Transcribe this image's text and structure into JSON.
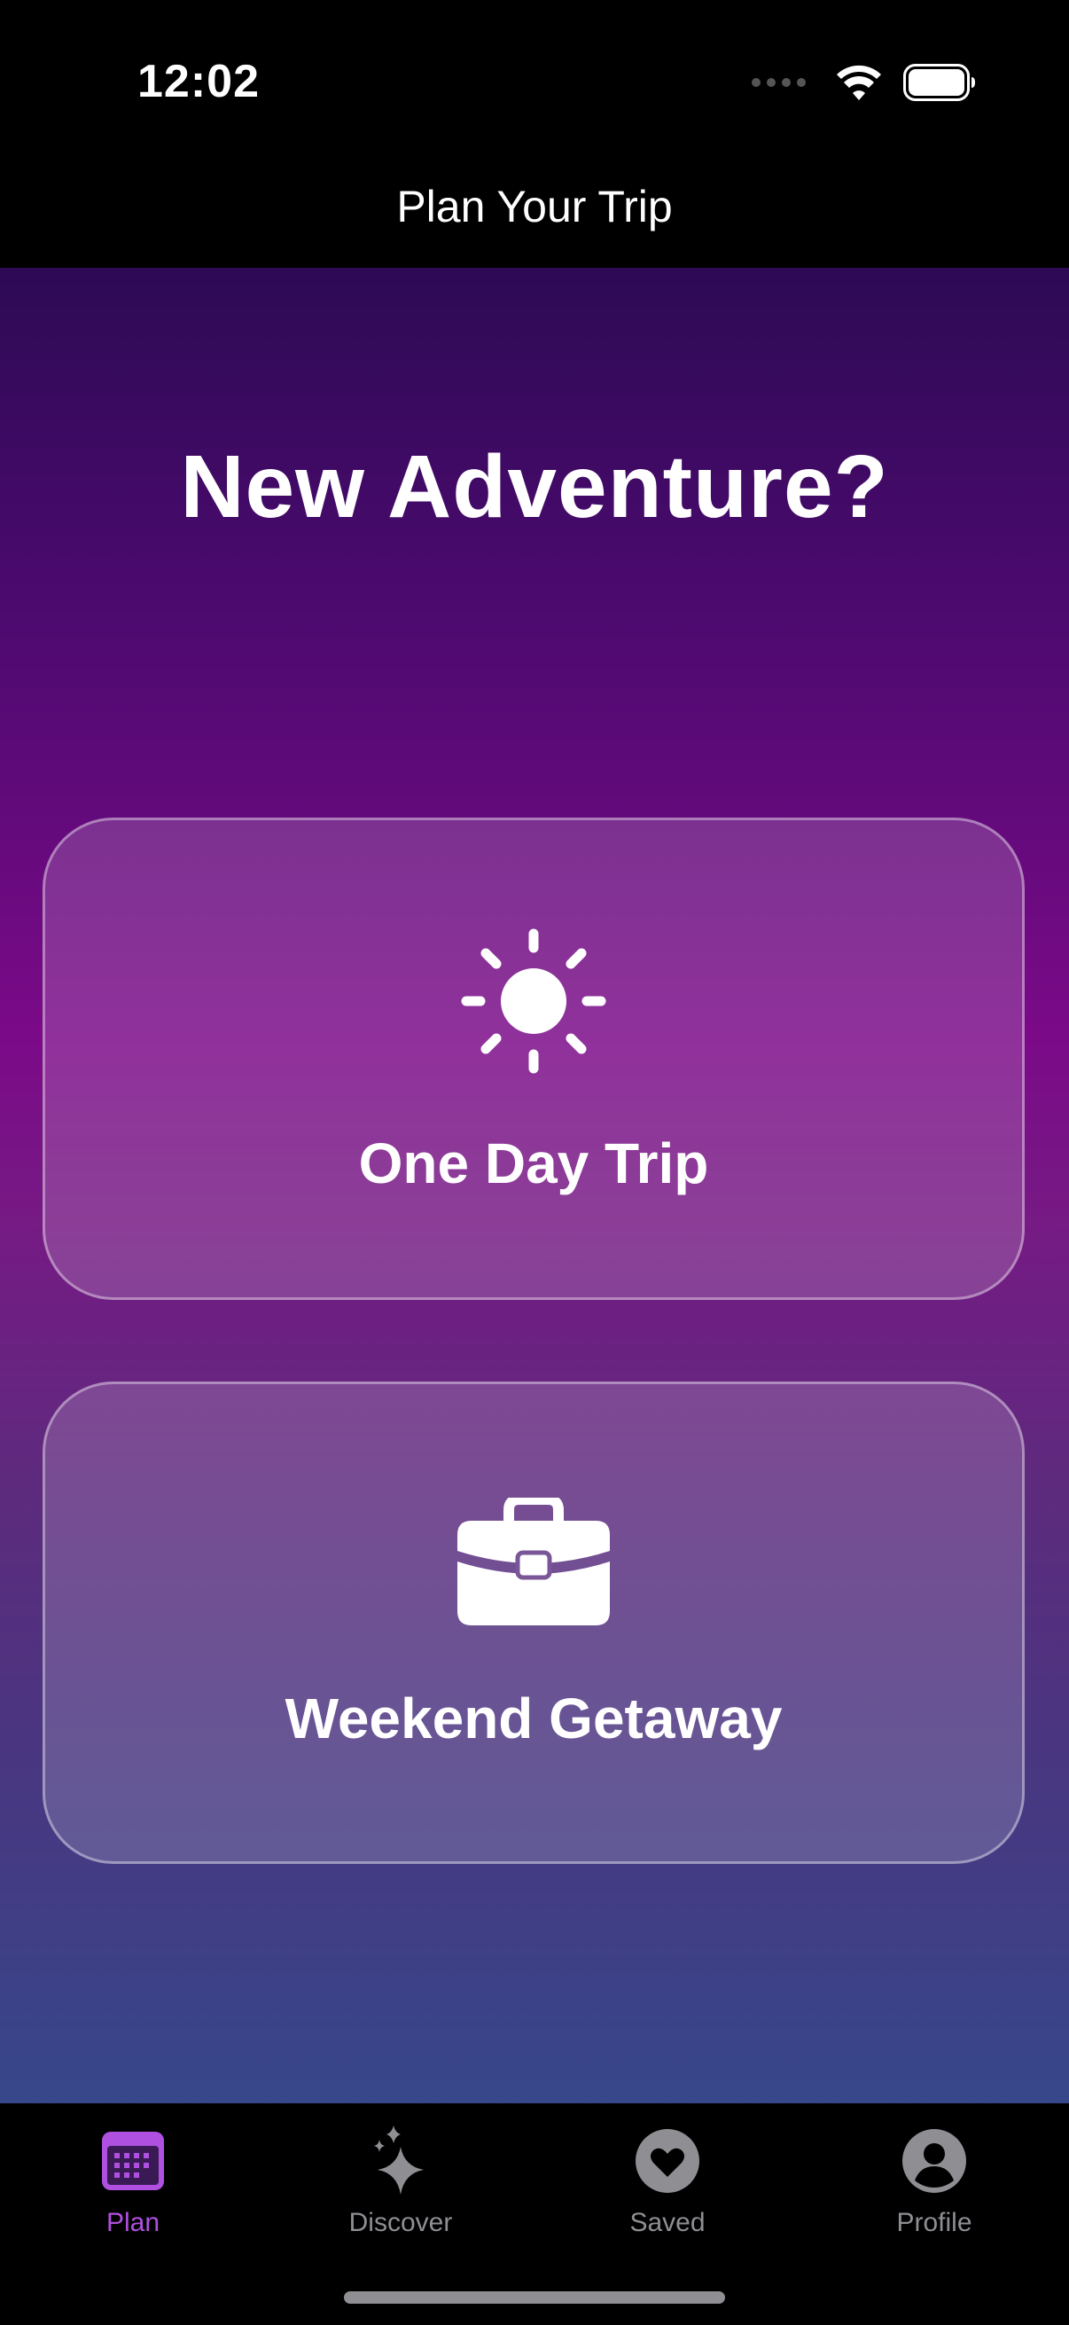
{
  "status_bar": {
    "time": "12:02"
  },
  "nav": {
    "title": "Plan Your Trip"
  },
  "main": {
    "headline": "New Adventure?",
    "options": [
      {
        "label": "One Day Trip",
        "icon": "sun-icon"
      },
      {
        "label": "Weekend Getaway",
        "icon": "briefcase-icon"
      }
    ]
  },
  "tab_bar": {
    "active": "Plan",
    "tabs": [
      {
        "label": "Plan",
        "icon": "calendar-icon"
      },
      {
        "label": "Discover",
        "icon": "sparkles-icon"
      },
      {
        "label": "Saved",
        "icon": "heart-icon"
      },
      {
        "label": "Profile",
        "icon": "person-icon"
      }
    ]
  },
  "colors": {
    "accent": "#b050e0",
    "inactive": "#8e8e93",
    "background_top": "#2d0a55",
    "background_bottom": "#37478a"
  }
}
